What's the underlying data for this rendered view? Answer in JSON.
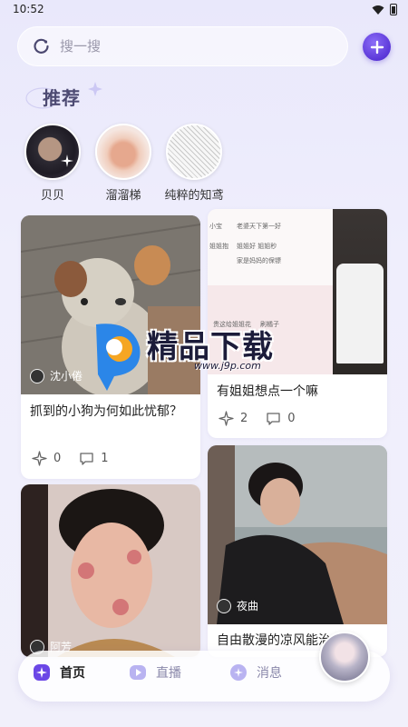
{
  "status": {
    "time": "10:52"
  },
  "search": {
    "placeholder": "搜一搜"
  },
  "recommend": {
    "title": "推荐",
    "items": [
      {
        "name": "贝贝"
      },
      {
        "name": "溜溜梯"
      },
      {
        "name": "纯粹的知鸢"
      }
    ]
  },
  "feed": {
    "cards": [
      {
        "author": "沈小倦",
        "title": "抓到的小狗为何如此忧郁？",
        "likes": "0",
        "comments": "1"
      },
      {
        "author": "",
        "title": "有姐姐想点一个嘛",
        "likes": "2",
        "comments": "0"
      },
      {
        "author": "阿芳",
        "title": "",
        "likes": "",
        "comments": ""
      },
      {
        "author": "夜曲",
        "title": "自由散漫的凉风能治愈我",
        "likes": "",
        "comments": ""
      }
    ],
    "chat_snippets": [
      "小宝",
      "老婆天下第一好",
      "姐姐抱",
      "姐姐好 姐姐秒",
      "家是妈妈的保镖",
      "贵这给姐姐花",
      "刷橘子"
    ]
  },
  "watermark": {
    "text": "精品下载",
    "url": "www.j9p.com"
  },
  "nav": {
    "home": "首页",
    "live": "直播",
    "messages": "消息"
  },
  "colors": {
    "accent": "#5b37d8",
    "title": "#4d4a72",
    "bg": "#eeedfb"
  }
}
